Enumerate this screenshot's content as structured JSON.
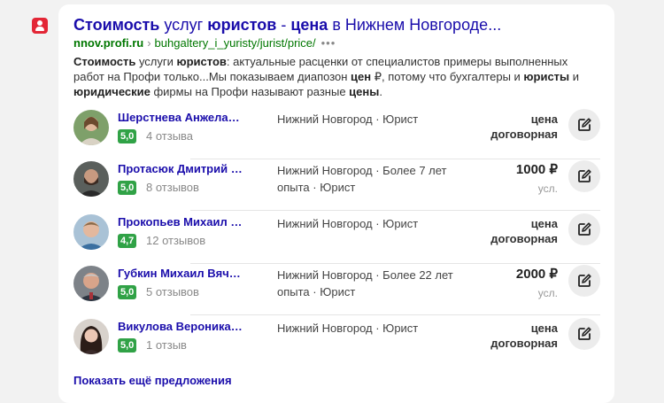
{
  "result": {
    "title_parts": [
      "Стоимость",
      " услуг ",
      "юристов",
      " - ",
      "цена",
      " в Нижнем Новгороде..."
    ],
    "domain": "nnov.profi.ru",
    "path": "buhgaltery_i_yuristy/jurist/price/",
    "more_label": "•••",
    "snippet_parts": [
      "Стоимость",
      " услуги ",
      "юристов",
      ": актуальные расценки от специалистов примеры выполненных работ на Профи только...Мы показываем диапозон ",
      "цен",
      " ₽, потому что бухгалтеры и ",
      "юристы",
      " и ",
      "юридические",
      " фирмы на Профи называют разные ",
      "цены",
      "."
    ]
  },
  "specialists": [
    {
      "name": "Шерстнева Анжела…",
      "rating": "5,0",
      "reviews": "4 отзыва",
      "meta": "Нижний Новгород · Юрист",
      "price_main": "цена",
      "price_sub": "договорная",
      "price_style": "negotiable"
    },
    {
      "name": "Протасюк Дмитрий …",
      "rating": "5,0",
      "reviews": "8 отзывов",
      "meta": "Нижний Новгород · Более 7 лет опыта · Юрист",
      "price_main": "1000 ₽",
      "price_sub": "усл.",
      "price_style": "fixed"
    },
    {
      "name": "Прокопьев Михаил …",
      "rating": "4,7",
      "reviews": "12 отзывов",
      "meta": "Нижний Новгород · Юрист",
      "price_main": "цена",
      "price_sub": "договорная",
      "price_style": "negotiable"
    },
    {
      "name": "Губкин Михаил Вяч…",
      "rating": "5,0",
      "reviews": "5 отзывов",
      "meta": "Нижний Новгород · Более 22 лет опыта · Юрист",
      "price_main": "2000 ₽",
      "price_sub": "усл.",
      "price_style": "fixed"
    },
    {
      "name": "Викулова Вероника…",
      "rating": "5,0",
      "reviews": "1 отзыв",
      "meta": "Нижний Новгород · Юрист",
      "price_main": "цена",
      "price_sub": "договорная",
      "price_style": "negotiable"
    }
  ],
  "show_more_label": "Показать ещё предложения",
  "colors": {
    "link": "#1a0dab",
    "url_green": "#007700",
    "rating_green": "#30a246",
    "favicon_red": "#e32636"
  }
}
